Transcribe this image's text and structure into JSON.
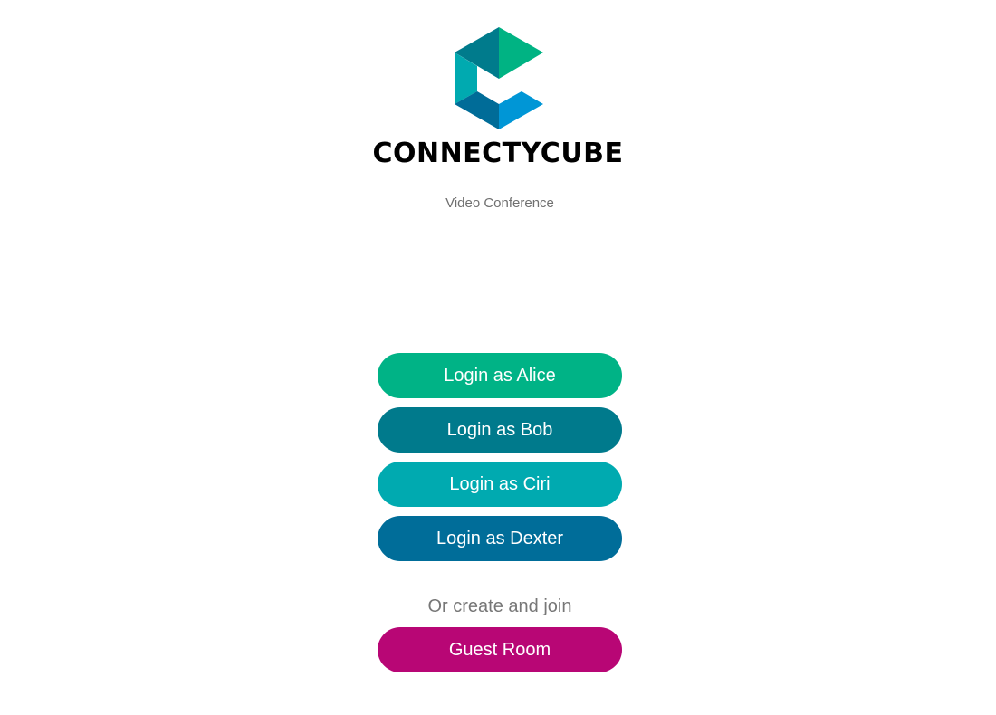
{
  "brand": {
    "name": "CONNECTYCUBE",
    "subtitle": "Video Conference",
    "logo_icon": "connectycube-c-logo-icon",
    "logo_colors": [
      "#00B383",
      "#007B8C",
      "#00AAB0",
      "#006C98",
      "#0096D6"
    ]
  },
  "login_buttons": [
    {
      "label": "Login as Alice",
      "color": "#00B386"
    },
    {
      "label": "Login as Bob",
      "color": "#007A8C"
    },
    {
      "label": "Login as Ciri",
      "color": "#00AAB0"
    },
    {
      "label": "Login as Dexter",
      "color": "#006D99"
    }
  ],
  "guest": {
    "prompt": "Or create and join",
    "button_label": "Guest Room",
    "color": "#B80675"
  }
}
